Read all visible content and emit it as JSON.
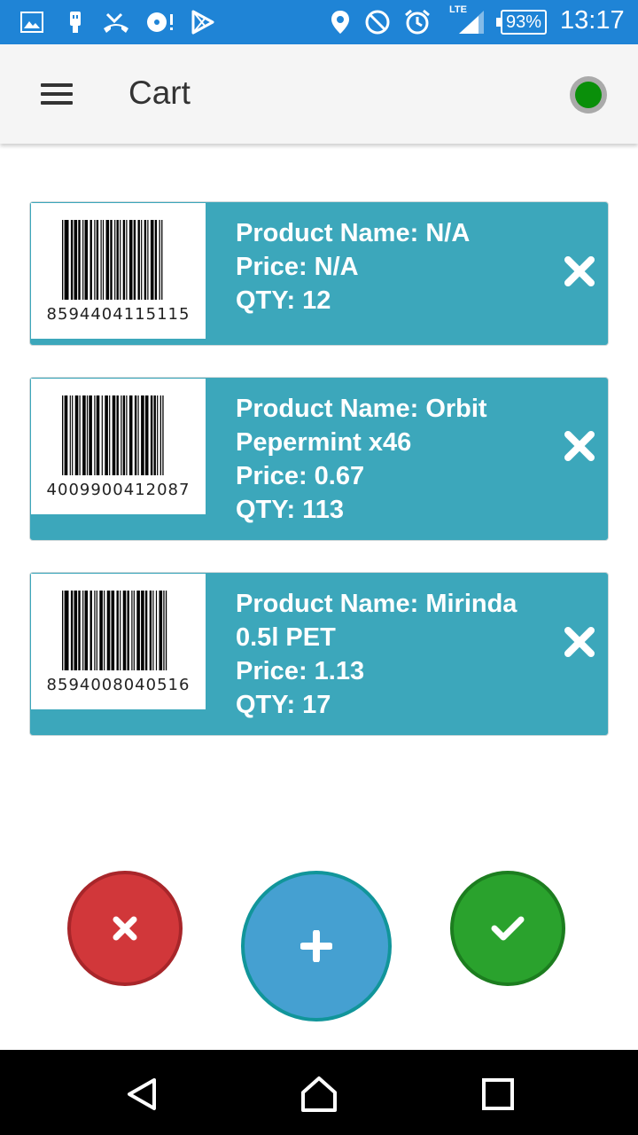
{
  "status_bar": {
    "icons": [
      "gallery-icon",
      "usb-debug-icon",
      "missed-call-icon",
      "media-icon",
      "play-store-icon",
      "location-icon",
      "do-not-disturb-icon",
      "alarm-icon",
      "signal-icon"
    ],
    "network": "LTE",
    "battery": "93%",
    "time": "13:17"
  },
  "toolbar": {
    "title": "Cart",
    "menu_icon": "hamburger-menu-icon",
    "connection_status_color": "#0a8f0a"
  },
  "cart": {
    "items": [
      {
        "barcode": "8594404115115",
        "name_line": "Product Name: N/A",
        "name_line2": "",
        "price_line": "Price: N/A",
        "qty_line": "QTY: 12"
      },
      {
        "barcode": "4009900412087",
        "name_line": "Product Name: Orbit",
        "name_line2": "Pepermint x46",
        "price_line": "Price: 0.67",
        "qty_line": "QTY: 113"
      },
      {
        "barcode": "8594008040516",
        "name_line": "Product Name: Mirinda",
        "name_line2": "0.5l PET",
        "price_line": "Price: 1.13",
        "qty_line": "QTY: 17"
      }
    ],
    "remove_icon": "close-icon",
    "card_color": "#3ca7bb"
  },
  "actions": {
    "cancel": {
      "icon": "close-icon",
      "color": "#d1373a"
    },
    "add": {
      "icon": "plus-icon",
      "color": "#45a0d1"
    },
    "confirm": {
      "icon": "check-icon",
      "color": "#2aa22d"
    }
  },
  "navigation": {
    "back": "back-icon",
    "home": "home-icon",
    "recents": "recents-icon"
  }
}
